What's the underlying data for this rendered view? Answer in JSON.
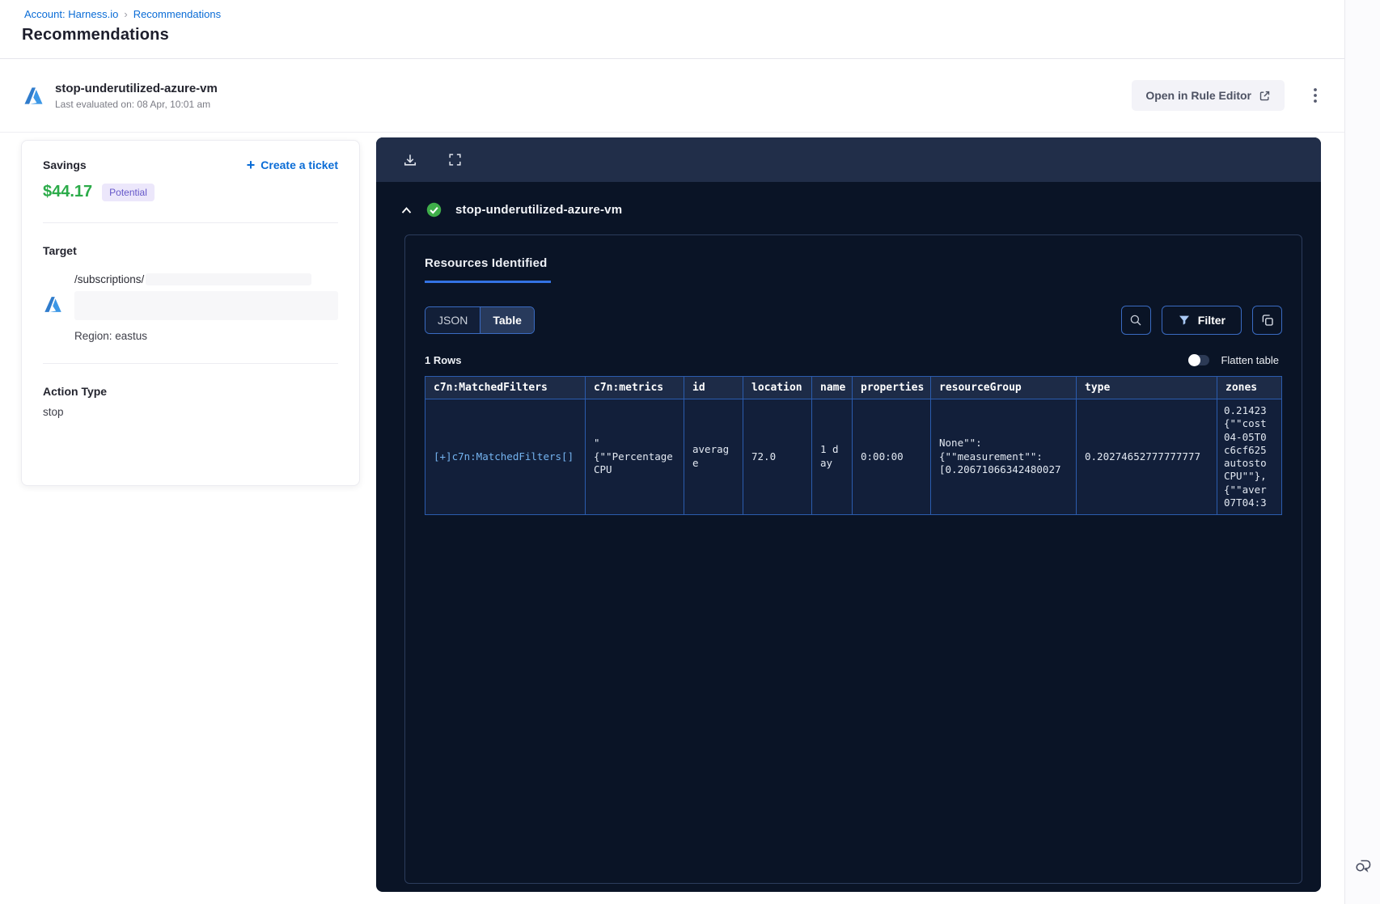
{
  "breadcrumb": {
    "account_link": "Account: Harness.io",
    "separator": "›",
    "current": "Recommendations"
  },
  "page": {
    "title": "Recommendations"
  },
  "recommendation": {
    "name": "stop-underutilized-azure-vm",
    "last_evaluated": "Last evaluated on: 08 Apr, 10:01 am",
    "open_rule_editor": "Open in Rule Editor"
  },
  "summary_card": {
    "savings_label": "Savings",
    "savings_value": "$44.17",
    "savings_badge": "Potential",
    "create_ticket": "Create a ticket",
    "target_label": "Target",
    "target_path": "/subscriptions/",
    "region": "Region: eastus",
    "action_type_label": "Action Type",
    "action_type_value": "stop"
  },
  "panel": {
    "resource_title": "stop-underutilized-azure-vm",
    "tab": "Resources Identified",
    "toggle_json": "JSON",
    "toggle_table": "Table",
    "filter": "Filter",
    "rows_count": "1 Rows",
    "flatten": "Flatten table",
    "table": {
      "columns": [
        "c7n:MatchedFilters",
        "c7n:metrics",
        "id",
        "location",
        "name",
        "properties",
        "resourceGroup",
        "type",
        "zones"
      ],
      "row": {
        "matched_filters": "[+]c7n:MatchedFilters[]",
        "metrics": "\"\n{\"\"Percentage\nCPU",
        "id": "average",
        "location": "72.0",
        "name": "1 day",
        "properties": "0:00:00",
        "resource_group": "None\"\":\n{\"\"measurement\"\":\n[0.20671066342480027",
        "type": "0.20274652777777777",
        "zones": "0.21423\n{\"\"cost\n04-05T0\nc6cf625\nautosto\nCPU\"\"},\n{\"\"aver\n07T04:3"
      }
    }
  },
  "colors": {
    "link_blue": "#0a6cd6",
    "savings_green": "#2bab49",
    "badge_bg": "#ece7fb",
    "badge_text": "#6557c9",
    "panel_bg": "#0a1426",
    "toolbar_bg": "#212e49",
    "table_border": "#2b5cad",
    "tab_underline": "#3372e3",
    "success_green": "#3fae4a",
    "cell_link": "#74b3f0"
  }
}
